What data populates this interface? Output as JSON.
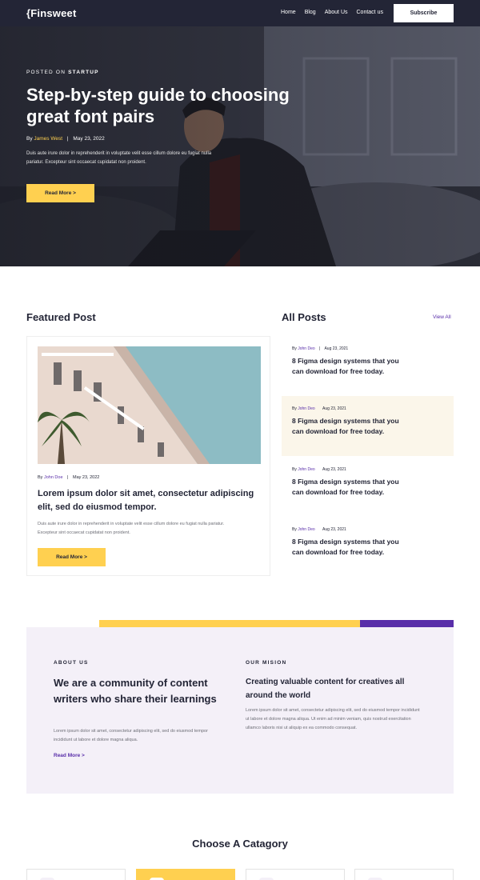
{
  "nav": {
    "logo": "{Finsweet",
    "links": [
      "Home",
      "Blog",
      "About Us",
      "Contact us"
    ],
    "subscribe": "Subscribe"
  },
  "hero": {
    "kicker_prefix": "POSTED ON",
    "kicker_category": "STARTUP",
    "title": "Step-by-step guide to choosing great font pairs",
    "by": "By",
    "author": "James West",
    "date": "May 23, 2022",
    "description": "Duis aute irure dolor in reprehenderit in voluptate velit esse cillum dolore eu fugiat nulla pariatur. Excepteur sint occaecat cupidatat non proident.",
    "button": "Read More >"
  },
  "featured": {
    "section_title": "Featured Post",
    "by": "By",
    "author": "John Doe",
    "date": "May 23, 2022",
    "title": "Lorem ipsum dolor sit amet, consectetur adipiscing elit, sed do eiusmod tempor.",
    "description": "Duis aute irure dolor in reprehenderit in voluptate velit esse cillum dolore eu fugiat nulla pariatur. Excepteur sint occaecat cupidatat non proident.",
    "button": "Read More >"
  },
  "all_posts": {
    "section_title": "All Posts",
    "view_all": "View All",
    "items": [
      {
        "by": "By",
        "author": "John Deo",
        "date": "Aug 23, 2021",
        "title": "8 Figma design systems that you can download for free today.",
        "highlighted": false
      },
      {
        "by": "By",
        "author": "John Deo",
        "date": "Aug 23, 2021",
        "title": "8 Figma design systems that you can download for free today.",
        "highlighted": true
      },
      {
        "by": "By",
        "author": "John Deo",
        "date": "Aug 23, 2021",
        "title": "8 Figma design systems that you can download for free today.",
        "highlighted": false
      },
      {
        "by": "By",
        "author": "John Deo",
        "date": "Aug 23, 2021",
        "title": "8 Figma design systems that you can download for free today.",
        "highlighted": false
      }
    ]
  },
  "about": {
    "label": "ABOUT US",
    "headline": "We are a community of content writers who share their learnings",
    "description": "Lorem ipsum dolor sit amet, consectetur adipiscing elit, sed do eiusmod tempor incididunt ut labore et dolore magna aliqua.",
    "link": "Read More >"
  },
  "mission": {
    "label": "OUR MISION",
    "headline": "Creating valuable content for creatives all around the world",
    "description": "Lorem ipsum dolor sit amet, consectetur adipiscing elit, sed do eiusmod tempor incididunt ut labore et dolore magna aliqua. Ut enim ad minim veniam, quis nostrud exercitation ullamco laboris nisi ut aliquip ex ea commodo consequat."
  },
  "category": {
    "title": "Choose A Catagory"
  },
  "colors": {
    "dark": "#232536",
    "yellow": "#ffd050",
    "purple": "#592ea9",
    "lavender": "#f4f0f8",
    "cream": "#fbf6ea"
  }
}
